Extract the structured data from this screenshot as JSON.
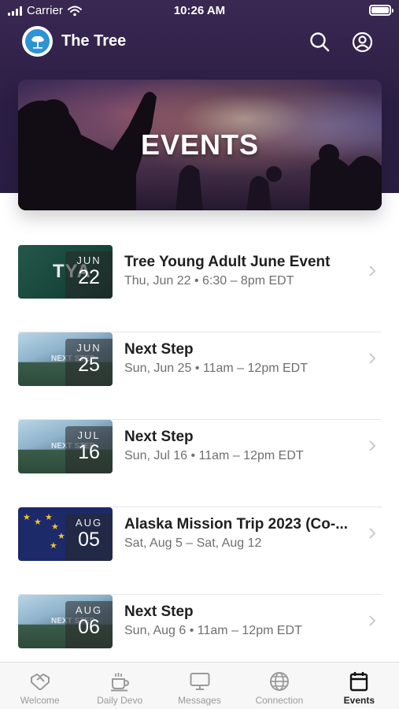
{
  "status_bar": {
    "carrier": "Carrier",
    "time": "10:26 AM"
  },
  "app": {
    "title": "The Tree"
  },
  "hero": {
    "title": "EVENTS"
  },
  "events": [
    {
      "title": "Tree Young Adult June Event",
      "subtitle": "Thu, Jun 22 • 6:30 – 8pm EDT",
      "month": "JUN",
      "day": "22",
      "thumb_text": "TYA"
    },
    {
      "title": "Next Step",
      "subtitle": "Sun, Jun 25 • 11am – 12pm EDT",
      "month": "JUN",
      "day": "25",
      "thumb_text": "NEXT STEP"
    },
    {
      "title": "Next Step",
      "subtitle": "Sun, Jul 16 • 11am – 12pm EDT",
      "month": "JUL",
      "day": "16",
      "thumb_text": "NEXT STEP"
    },
    {
      "title": "Alaska Mission Trip 2023 (Co-...",
      "subtitle": "Sat, Aug 5 – Sat, Aug 12",
      "month": "AUG",
      "day": "05",
      "thumb_text": ""
    },
    {
      "title": "Next Step",
      "subtitle": "Sun, Aug 6 • 11am – 12pm EDT",
      "month": "AUG",
      "day": "06",
      "thumb_text": "NEXT STEP"
    }
  ],
  "tabs": [
    {
      "label": "Welcome",
      "icon": "handshake-icon",
      "active": false
    },
    {
      "label": "Daily Devo",
      "icon": "coffee-cup-icon",
      "active": false
    },
    {
      "label": "Messages",
      "icon": "monitor-icon",
      "active": false
    },
    {
      "label": "Connection",
      "icon": "globe-icon",
      "active": false
    },
    {
      "label": "Events",
      "icon": "calendar-icon",
      "active": true
    }
  ],
  "colors": {
    "header": "#2b1e45",
    "logo_blue": "#2e93d3",
    "accent_flag": "#1c2a6a"
  }
}
